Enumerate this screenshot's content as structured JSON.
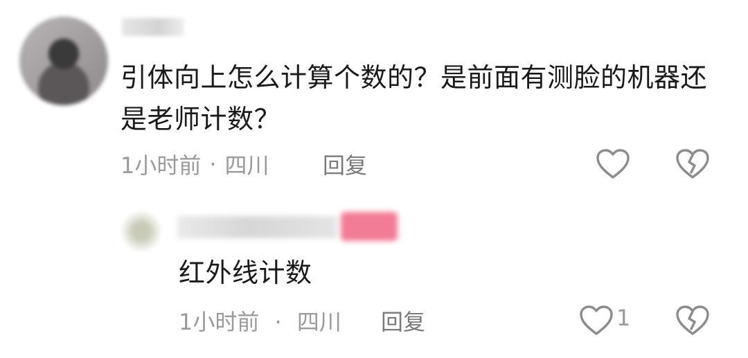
{
  "comment": {
    "text": "引体向上怎么计算个数的？是前面有测脸的机器还是老师计数？",
    "time": "1小时前",
    "separator": "·",
    "location": "四川",
    "reply_label": "回复",
    "like_icon": "heart-outline-icon",
    "dislike_icon": "broken-heart-icon"
  },
  "reply": {
    "text": "红外线计数",
    "time": "1小时前",
    "separator": "·",
    "location": "四川",
    "reply_label": "回复",
    "like_count": "1",
    "like_icon": "heart-outline-icon",
    "dislike_icon": "broken-heart-icon"
  },
  "colors": {
    "text": "#1a1a1a",
    "meta": "#9a9a9a",
    "icon": "#8c8c8c",
    "badge": "#f27b96"
  }
}
